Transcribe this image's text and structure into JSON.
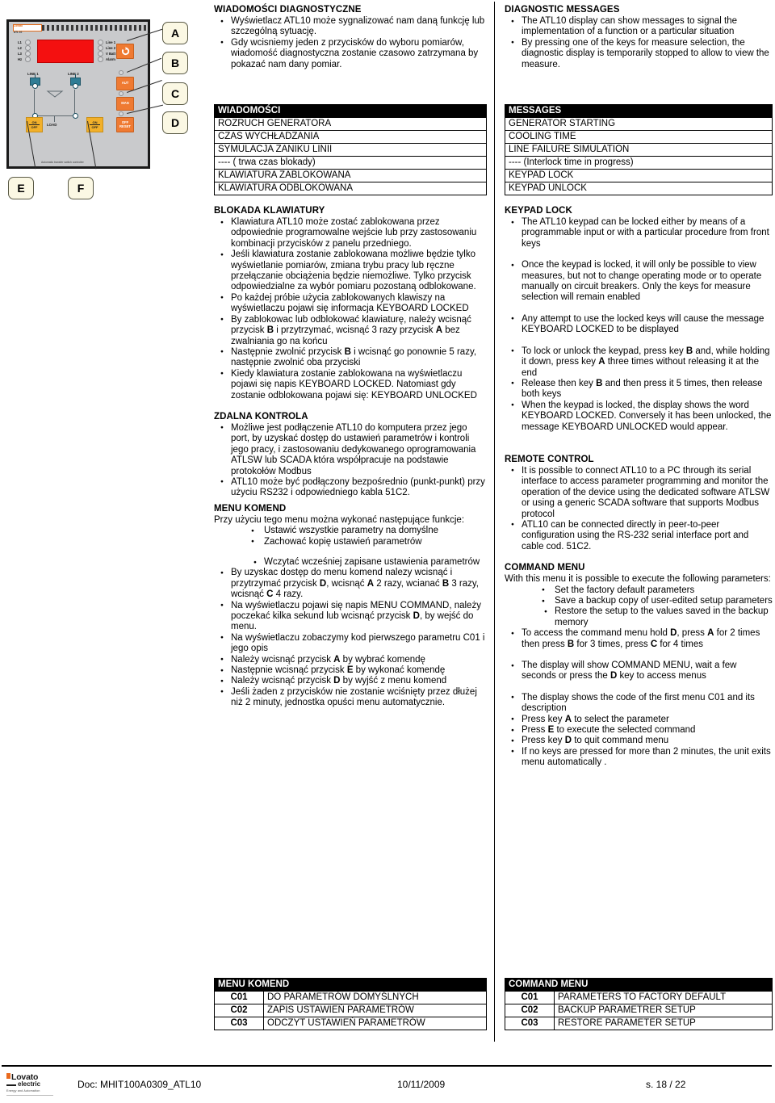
{
  "figure": {
    "device_brand": "Lovato",
    "device_model": "ATL 10",
    "lamps_left": [
      "L1",
      "L2",
      "L3",
      "Hz"
    ],
    "lamps_right": [
      "Line 1",
      "Line 2",
      "V Batt",
      "Alarm"
    ],
    "key_a_label": "↻",
    "key_b_label": "AUT",
    "key_c_label": "MAN",
    "key_d_label": "OFF\nRESET",
    "line1_label": "LINE 1",
    "line2_label": "LINE 2",
    "load_label": "LOAD",
    "on_label": "ON",
    "off_label": "OFF",
    "subtitle": "Automatic transfer switch controller",
    "callouts": [
      "A",
      "B",
      "C",
      "D",
      "E",
      "F"
    ]
  },
  "pl": {
    "s1_title": "WIADOMOŚCI DIAGNOSTYCZNE",
    "s1_bullets": [
      "Wyświetlacz ATL10 może sygnalizować nam daną funkcję lub szczególną sytuację.",
      "Gdy wcisniemy jeden z przycisków do wyboru pomiarów, wiadomość diagnostyczna zostanie czasowo zatrzymana by pokazać nam dany pomiar."
    ],
    "msg_table_header": "WIADOMOŚCI",
    "msg_table_rows": [
      "ROZRUCH GENERATORA",
      "CZAS WYCHŁADZANIA",
      "SYMULACJA ZANIKU LINII",
      "---- ( trwa czas blokady)",
      "KLAWIATURA ZABLOKOWANA",
      "KLAWIATURA ODBLOKOWANA"
    ],
    "s2_title": "BLOKADA KLAWIATURY",
    "s2_bullets": [
      "Klawiatura ATL10 może zostać zablokowana przez odpowiednie programowalne wejście lub przy zastosowaniu kombinacji przycisków z panelu przedniego.",
      "Jeśli klawiatura zostanie zablokowana możliwe będzie tylko wyświetlanie pomiarów, zmiana trybu pracy lub ręczne przełączanie obciążenia będzie niemożliwe. Tylko przycisk odpowiedzialne za wybór pomiaru pozostaną odblokowane.",
      "Po każdej próbie użycia zablokowanych klawiszy na wyświetlaczu pojawi się informacja KEYBOARD LOCKED",
      "By zablokowac lub odblokować klawiaturę, należy wcisnąć przycisk B i przytrzymać, wcisnąć 3 razy przycisk A bez zwalniania go na końcu",
      "Następnie zwolnić przycisk B i wcisnąć go ponownie 5 razy, następnie zwolnić oba przyciski",
      "Kiedy klawiatura zostanie zablokowana na wyświetlaczu pojawi się napis KEYBOARD LOCKED. Natomiast gdy zostanie odblokowana pojawi się: KEYBOARD UNLOCKED"
    ],
    "s3_title": "ZDALNA KONTROLA",
    "s3_bullets": [
      "Możliwe jest podłączenie ATL10 do komputera przez jego port, by uzyskać dostęp do ustawień parametrów i kontroli jego pracy, i zastosowaniu dedykowanego oprogramowania ATLSW lub SCADA która współpracuje na podstawie protokołów Modbus",
      "ATL10  może być podłączony bezpośrednio (punkt-punkt) przy użyciu RS232 i odpowiedniego kabla 51C2."
    ],
    "s4_title": "MENU KOMEND",
    "s4_lead": " Przy użyciu tego menu można wykonać następujące funkcje:",
    "s4_sub_bullets": [
      "Ustawić wszystkie parametry na domyślne",
      "Zachować kopię ustawień parametrów"
    ],
    "s4_sub_bullets2": [
      "Wczytać wcześniej zapisane ustawienia parametrów"
    ],
    "s4_bullets": [
      "By uzyskac dostęp do menu komend nalezy wcisnąć i przytrzymać przycisk D, wcisnąć A 2 razy, wcianać B 3 razy, wcisnąć C 4 razy.",
      "Na wyświetlaczu pojawi się napis MENU COMMAND, należy poczekać kilka sekund lub wcisnąć przycisk D, by wejść do menu.",
      "Na wyświetlaczu zobaczymy kod pierwszego parametru C01 i jego opis",
      "Należy wcisnąć przycisk A by wybrać komendę",
      "Następnie wcisnąć przycisk E by wykonać komendę",
      "Należy wcisnąć przycisk D by wyjść z menu komend",
      "Jeśli żaden z przycisków nie zostanie wciśnięty przez dłużej niż 2 minuty, jednostka opuści menu automatycznie."
    ],
    "cmd_table_header": "MENU KOMEND",
    "cmd_table_rows": [
      {
        "code": "C01",
        "desc": "DO PARAMETRÓW DOMYŚLNYCH"
      },
      {
        "code": "C02",
        "desc": "ZAPIS USTAWIEŃ PARAMETRÓW"
      },
      {
        "code": "C03",
        "desc": "ODCZYT USTAWIEŃ PARAMETRÓW"
      }
    ]
  },
  "en": {
    "s1_title": "DIAGNOSTIC MESSAGES",
    "s1_bullets": [
      "The ATL10 display can show messages to signal the implementation of a function or a particular situation",
      "By pressing one of the keys for measure selection, the diagnostic display is temporarily stopped to allow to view the measure."
    ],
    "msg_table_header": "MESSAGES",
    "msg_table_rows": [
      "GENERATOR STARTING",
      "COOLING TIME",
      "LINE FAILURE SIMULATION",
      "---- (Interlock time in progress)",
      "KEYPAD LOCK",
      "KEYPAD UNLOCK"
    ],
    "s2_title": "KEYPAD LOCK",
    "s2_bullets": [
      "The ATL10 keypad can be locked either by means of a programmable input or with a particular procedure from front keys",
      "Once the keypad is locked, it will only be possible to view measures, but not to change operating mode or to operate manually on circuit breakers. Only the keys for measure selection will remain enabled",
      "Any attempt to use the locked keys will cause the message KEYBOARD LOCKED to be displayed",
      "To lock or unlock the keypad, press key B and, while holding it down, press key A three times without releasing it at the end",
      "Release then key B and then press it 5 times, then release both keys",
      "When the keypad is locked, the display shows the word KEYBOARD LOCKED.  Conversely it has been unlocked, the message KEYBOARD UNLOCKED would appear."
    ],
    "s3_title": "REMOTE CONTROL",
    "s3_bullets": [
      "It is possible to connect ATL10 to a PC through its serial interface to access parameter programming and monitor the operation of the device using the dedicated software ATLSW or using a generic SCADA software that supports Modbus protocol",
      " ATL10 can be connected directly in peer-to-peer configuration using the RS-232 serial interface port and cable cod. 51C2."
    ],
    "s4_title": "COMMAND MENU",
    "s4_lead": "With this menu it is possible to execute the following parameters:",
    "s4_sub_bullets": [
      "Set the factory default parameters",
      "Save a backup copy of user-edited setup parameters"
    ],
    "s4_sub_bullets2": [
      "Restore the setup to the values saved in the backup memory"
    ],
    "s4_bullets": [
      "To access the command menu hold D, press A for 2 times then press B for 3 times, press C for 4 times",
      "The display will show COMMAND MENU, wait a few seconds or press the D key to access menus",
      "The display shows the code of the first menu C01 and its description",
      "Press key A  to select the parameter",
      "Press E to execute the selected command",
      "Press key D to quit command menu",
      "If no keys are pressed for more than 2 minutes, the unit exits menu automatically ."
    ],
    "cmd_table_header": "COMMAND MENU",
    "cmd_table_rows": [
      {
        "code": "C01",
        "desc": "PARAMETERS TO FACTORY DEFAULT"
      },
      {
        "code": "C02",
        "desc": "BACKUP PARAMETRER SETUP"
      },
      {
        "code": "C03",
        "desc": "RESTORE PARAMETER SETUP"
      }
    ]
  },
  "footer": {
    "logo_line1": "Lovato",
    "logo_line2": "electric",
    "logo_tagline": "Energy and Automation",
    "doc": "Doc: MHIT100A0309_ATL10",
    "date": "10/11/2009",
    "page": "s. 18 / 22"
  }
}
